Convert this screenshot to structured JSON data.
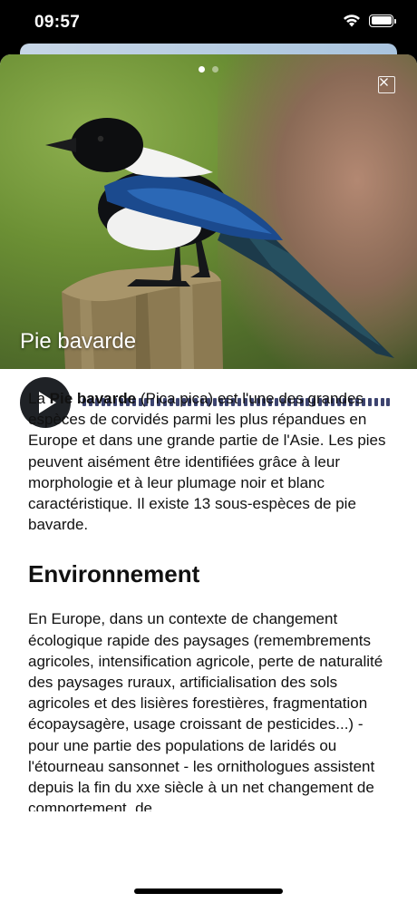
{
  "status_bar": {
    "time": "09:57",
    "wifi_icon": "wifi-icon",
    "battery_icon": "battery-icon"
  },
  "hero": {
    "title": "Pie bavarde",
    "page_count": 2,
    "active_page": 1,
    "close_icon": "close-icon"
  },
  "player": {
    "play_icon": "play-icon",
    "waveform_segments": 50
  },
  "article": {
    "intro_prefix": "La ",
    "intro_bold": "Pie bavarde",
    "intro_rest": " (Pica pica) est l'une des grandes espèces de corvidés parmi les plus répandues en Europe et dans une grande partie de l'Asie. Les pies peuvent aisément être identifiées grâce à leur morphologie et à leur plumage noir et blanc caractéristique. Il existe 13 sous-espèces de pie bavarde.",
    "section_title": "Environnement",
    "section_text": "En Europe, dans un contexte de changement écologique rapide des paysages (remembrements agricoles, intensification agricole, perte de naturalité des paysages ruraux, artificialisation des sols agricoles et des lisières forestières, fragmentation écopaysagère, usage croissant de pesticides...) - pour une partie des populations de laridés ou l'étourneau sansonnet - les ornithologues assistent depuis la fin du xxe siècle à un net changement de comportement, de"
  }
}
